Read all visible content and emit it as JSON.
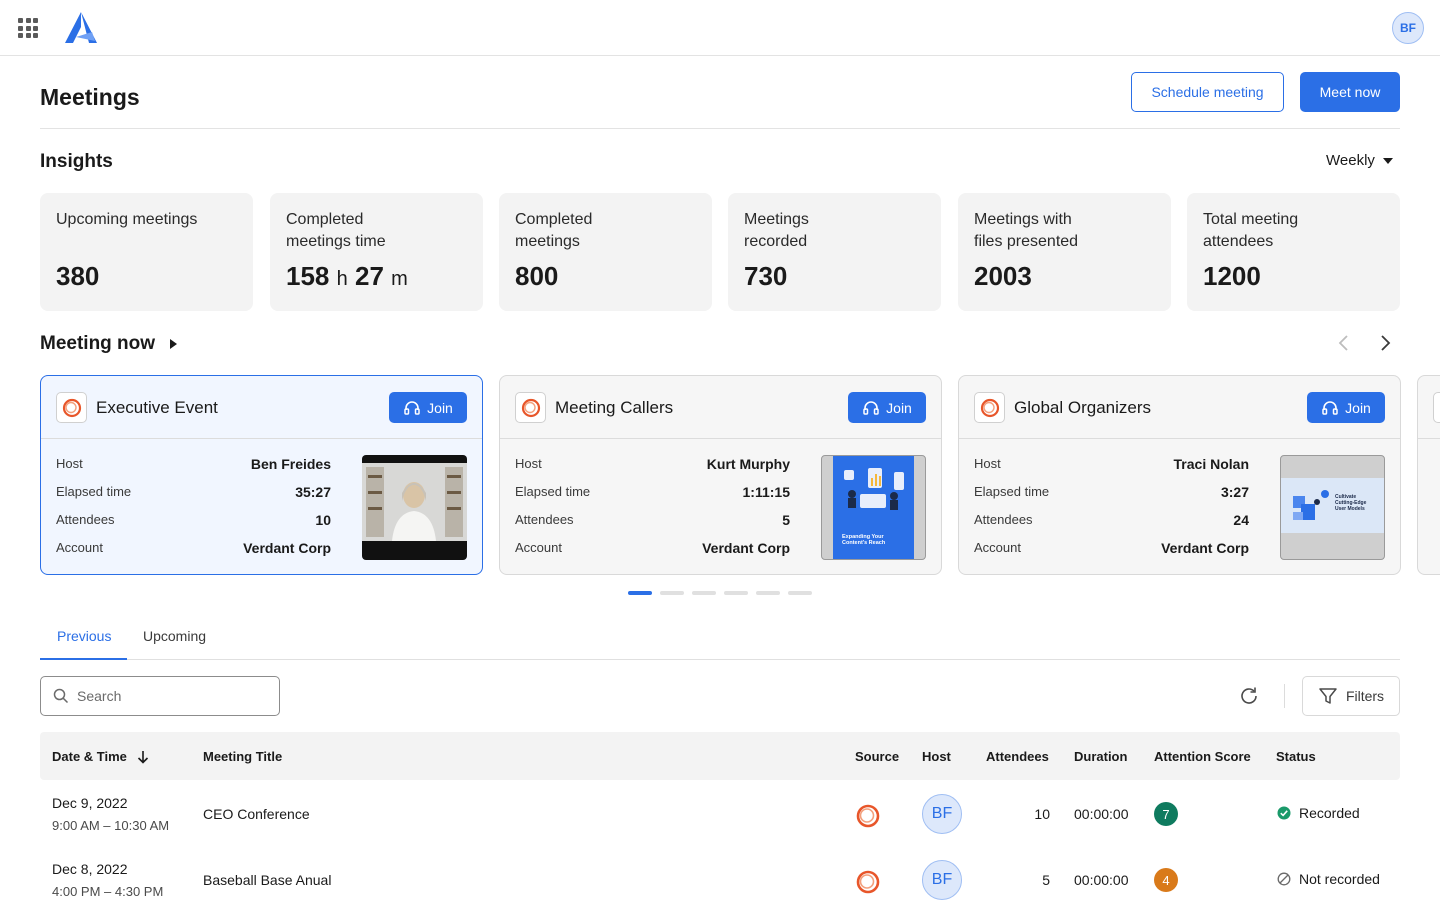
{
  "header": {
    "page_title": "Meetings",
    "user_initials": "BF",
    "schedule_label": "Schedule meeting",
    "meet_now_label": "Meet now"
  },
  "insights": {
    "title": "Insights",
    "period": "Weekly",
    "stats": [
      {
        "label": "Upcoming meetings",
        "value": "380"
      },
      {
        "label": "Completed meetings time",
        "hours": "158",
        "hours_unit": "h",
        "minutes": "27",
        "minutes_unit": "m"
      },
      {
        "label": "Completed meetings",
        "value": "800"
      },
      {
        "label": "Meetings recorded",
        "value": "730"
      },
      {
        "label": "Meetings with files presented",
        "value": "2003"
      },
      {
        "label": "Total meeting attendees",
        "value": "1200"
      }
    ]
  },
  "meeting_now": {
    "title": "Meeting now",
    "join_label": "Join",
    "labels": {
      "host": "Host",
      "elapsed": "Elapsed time",
      "attendees": "Attendees",
      "account": "Account"
    },
    "cards": [
      {
        "title": "Executive Event",
        "host": "Ben Freides",
        "elapsed": "35:27",
        "attendees": "10",
        "account": "Verdant Corp",
        "thumb": "video"
      },
      {
        "title": "Meeting Callers",
        "host": "Kurt Murphy",
        "elapsed": "1:11:15",
        "attendees": "5",
        "account": "Verdant Corp",
        "thumb": "slide",
        "slide_text": "Expanding Your Content's Reach"
      },
      {
        "title": "Global Organizers",
        "host": "Traci Nolan",
        "elapsed": "3:27",
        "attendees": "24",
        "account": "Verdant Corp",
        "thumb": "slide2",
        "slide_text": "Cultivate Cutting-Edge User Models"
      }
    ],
    "page_count": 6,
    "active_page": 0
  },
  "tabs": [
    {
      "label": "Previous",
      "active": true
    },
    {
      "label": "Upcoming",
      "active": false
    }
  ],
  "search": {
    "placeholder": "Search"
  },
  "filters_label": "Filters",
  "table": {
    "headers": {
      "datetime": "Date & Time",
      "title": "Meeting Title",
      "source": "Source",
      "host": "Host",
      "attendees": "Attendees",
      "duration": "Duration",
      "score": "Attention Score",
      "status": "Status"
    },
    "rows": [
      {
        "date": "Dec 9, 2022",
        "time": "9:00 AM – 10:30 AM",
        "title": "CEO Conference",
        "host": "BF",
        "attendees": "10",
        "duration": "00:00:00",
        "score": "7",
        "score_color": "#0f7b5f",
        "status": "Recorded",
        "status_type": "recorded"
      },
      {
        "date": "Dec 8, 2022",
        "time": "4:00 PM – 4:30 PM",
        "title": "Baseball Base Anual",
        "host": "BF",
        "attendees": "5",
        "duration": "00:00:00",
        "score": "4",
        "score_color": "#d97a1a",
        "status": "Not recorded",
        "status_type": "not-recorded"
      }
    ]
  },
  "colors": {
    "accent": "#2b6fe6",
    "recorded": "#1a9a6a"
  }
}
